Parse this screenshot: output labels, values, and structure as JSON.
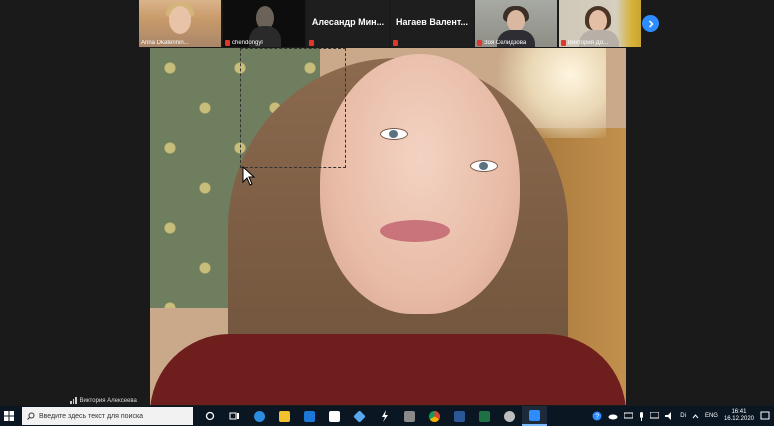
{
  "participants": [
    {
      "name": "Anna Dkaterinin...",
      "mic_muted": false
    },
    {
      "name": "chendongyl",
      "mic_muted": true
    },
    {
      "name": "Алесандр Мин...",
      "mic_muted": true
    },
    {
      "name": "Нагаев Валент...",
      "mic_muted": true
    },
    {
      "name": "Зоя Селидзова",
      "mic_muted": true
    },
    {
      "name": "Виктория До...",
      "mic_muted": true
    }
  ],
  "active_speaker": "Виктория Алексеева",
  "taskbar": {
    "search_placeholder": "Введите здесь текст для поиска",
    "language": "ENG",
    "time": "16:41",
    "date": "16.12.2020",
    "tray_misc": "Di"
  },
  "colors": {
    "zoom_blue": "#2d8cff",
    "mic_muted_red": "#e0362c",
    "taskbar_bg": "#0b1623"
  },
  "icons": [
    "windows-start-icon",
    "search-icon",
    "task-view-icon",
    "edge-icon",
    "file-explorer-icon",
    "mail-icon",
    "amazon-icon",
    "dropbox-icon",
    "winamp-icon",
    "folder-icon",
    "chrome-icon",
    "word-icon",
    "excel-icon",
    "browser-icon",
    "zoom-icon"
  ]
}
